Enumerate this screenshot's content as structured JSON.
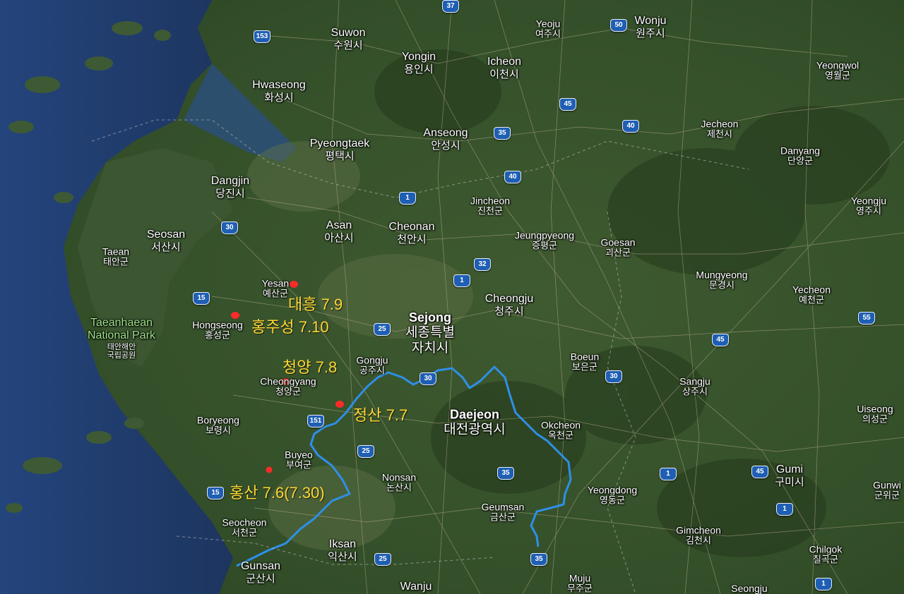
{
  "colors": {
    "annotation": "#ffd634",
    "river": "#2f8fe8",
    "marker": "#ff2a2a",
    "shield": "#1f5fb3"
  },
  "cities": {
    "suwon": {
      "en": "Suwon",
      "ko": "수원시"
    },
    "yongin": {
      "en": "Yongin",
      "ko": "용인시"
    },
    "icheon": {
      "en": "Icheon",
      "ko": "이천시"
    },
    "yeoju": {
      "en": "Yeoju",
      "ko": "여주시"
    },
    "wonju": {
      "en": "Wonju",
      "ko": "원주시"
    },
    "yeongwol": {
      "en": "Yeongwol",
      "ko": "영월군"
    },
    "hwaseong": {
      "en": "Hwaseong",
      "ko": "화성시"
    },
    "anseong": {
      "en": "Anseong",
      "ko": "안성시"
    },
    "jecheon": {
      "en": "Jecheon",
      "ko": "제천시"
    },
    "danyang": {
      "en": "Danyang",
      "ko": "단양군"
    },
    "pyeongtaek": {
      "en": "Pyeongtaek",
      "ko": "평택시"
    },
    "dangjin": {
      "en": "Dangjin",
      "ko": "당진시"
    },
    "jincheon": {
      "en": "Jincheon",
      "ko": "진천군"
    },
    "yeongju": {
      "en": "Yeongju",
      "ko": "영주시"
    },
    "seosan": {
      "en": "Seosan",
      "ko": "서산시"
    },
    "asan": {
      "en": "Asan",
      "ko": "아산시"
    },
    "cheonan": {
      "en": "Cheonan",
      "ko": "천안시"
    },
    "jeungpyeong": {
      "en": "Jeungpyeong",
      "ko": "증평군"
    },
    "goesan": {
      "en": "Goesan",
      "ko": "괴산군"
    },
    "taean": {
      "en": "Taean",
      "ko": "태안군"
    },
    "mungyeong": {
      "en": "Mungyeong",
      "ko": "문경시"
    },
    "yesan": {
      "en": "Yesan",
      "ko": "예산군"
    },
    "yecheon": {
      "en": "Yecheon",
      "ko": "예천군"
    },
    "cheongju": {
      "en": "Cheongju",
      "ko": "청주시"
    },
    "sejong": {
      "en": "Sejong",
      "ko": "세종특별",
      "ko2": "자치시"
    },
    "taeanhaean": {
      "en": "Taeanhaean",
      "en2": "National Park",
      "ko": "태안해안",
      "ko2": "국립공원"
    },
    "hongseong": {
      "en": "Hongseong",
      "ko": "홍성군"
    },
    "gongju": {
      "en": "Gongju",
      "ko": "공주시"
    },
    "boeun": {
      "en": "Boeun",
      "ko": "보은군"
    },
    "sangju": {
      "en": "Sangju",
      "ko": "상주시"
    },
    "cheongyang": {
      "en": "Cheongyang",
      "ko": "청양군"
    },
    "daejeon": {
      "en": "Daejeon",
      "ko": "대전광역시"
    },
    "uiseong": {
      "en": "Uiseong",
      "ko": "의성군"
    },
    "boryeong": {
      "en": "Boryeong",
      "ko": "보령시"
    },
    "okcheon": {
      "en": "Okcheon",
      "ko": "옥천군"
    },
    "buyeo": {
      "en": "Buyeo",
      "ko": "부여군"
    },
    "gumi": {
      "en": "Gumi",
      "ko": "구미시"
    },
    "nonsan": {
      "en": "Nonsan",
      "ko": "논산시"
    },
    "yeongdong": {
      "en": "Yeongdong",
      "ko": "영동군"
    },
    "gunwi": {
      "en": "Gunwi",
      "ko": "군위군"
    },
    "geumsan": {
      "en": "Geumsan",
      "ko": "금산군"
    },
    "seocheon": {
      "en": "Seocheon",
      "ko": "서천군"
    },
    "gimcheon": {
      "en": "Gimcheon",
      "ko": "김천시"
    },
    "iksan": {
      "en": "Iksan",
      "ko": "익산시"
    },
    "chilgok": {
      "en": "Chilgok",
      "ko": "칠곡군"
    },
    "gunsan": {
      "en": "Gunsan",
      "ko": "군산시"
    },
    "muju": {
      "en": "Muju",
      "ko": "무주군"
    },
    "wanju": {
      "en": "Wanju"
    },
    "seongju": {
      "en": "Seongju"
    }
  },
  "highways": [
    "37",
    "153",
    "50",
    "45",
    "35",
    "40",
    "1",
    "30",
    "32",
    "15",
    "25",
    "55",
    "151",
    "35",
    "1",
    "45",
    "1",
    "15",
    "25",
    "35",
    "1",
    "30",
    "45"
  ],
  "annotations": {
    "daeheung": "대흥 7.9",
    "hongjuseong": "홍주성 7.10",
    "cheongyang": "청양 7.8",
    "jeongsan": "정산 7.7",
    "hongsan": "홍산 7.6(7.30)"
  }
}
